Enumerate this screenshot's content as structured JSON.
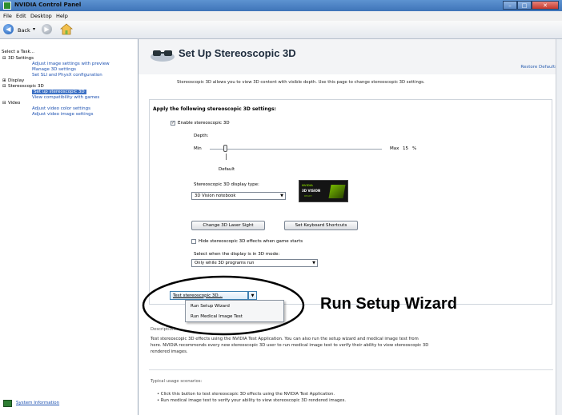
{
  "window": {
    "title": "NVIDIA Control Panel",
    "min": "–",
    "max": "□",
    "close": "✕"
  },
  "menu": {
    "file": "File",
    "edit": "Edit",
    "desktop": "Desktop",
    "help": "Help"
  },
  "toolbar": {
    "back": "Back",
    "back_arrow": "◀",
    "forward_arrow": "▶",
    "dropdown_arrow": "▾"
  },
  "sidebar": {
    "header": "Select a Task...",
    "items": [
      {
        "label": "3D Settings",
        "prefix": "⊟"
      },
      {
        "label": "Adjust image settings with preview"
      },
      {
        "label": "Manage 3D settings"
      },
      {
        "label": "Set SLI and PhysX configuration"
      },
      {
        "label": "Display",
        "prefix": "⊞"
      },
      {
        "label": "Stereoscopic 3D",
        "prefix": "⊟"
      },
      {
        "label": "Set up stereoscopic 3D"
      },
      {
        "label": "View compatibility with games"
      },
      {
        "label": "Video",
        "prefix": "⊟"
      },
      {
        "label": "Adjust video color settings"
      },
      {
        "label": "Adjust video image settings"
      }
    ],
    "system_info": "System Information"
  },
  "page": {
    "title": "Set Up Stereoscopic 3D",
    "restore": "Restore Defaults",
    "description": "Stereoscopic 3D allows you to view 3D content with visible depth. Use this page to change stereoscopic 3D settings.",
    "apply_heading": "Apply the following stereoscopic 3D settings:",
    "enable_label": "Enable stereoscopic 3D",
    "enable_checked": "✓",
    "depth_label": "Depth:",
    "depth_min": "Min",
    "depth_max": "Max",
    "depth_value": "15",
    "depth_unit": "%",
    "depth_default": "Default",
    "display_type_label": "Stereoscopic 3D display type:",
    "display_type_value": "3D Vision notebook",
    "badge": {
      "line1": "NVIDIA",
      "line2": "3D VISION",
      "line3": "READY"
    },
    "laser_button": "Change 3D Laser Sight",
    "shortcuts_button": "Set Keyboard Shortcuts",
    "hide_effects_label": "Hide stereoscopic 3D effects when game starts",
    "mode_label": "Select when the display is in 3D mode:",
    "mode_value": "Only while 3D programs run",
    "test_button": "Test stereoscopic 3D...",
    "menu_items": [
      "Run Setup Wizard",
      "Run Medical Image Test"
    ],
    "callout": "Run Setup Wizard",
    "desc_label": "Description:",
    "desc_lines": [
      "Test stereoscopic 3D effects using the NVIDIA Test Application. You can also run the setup wizard and medical image test from",
      "here. NVIDIA recommends every new stereoscopic 3D user to run medical image test to verify their ability to view stereoscopic 3D",
      "rendered images."
    ],
    "usage_label": "Typical usage scenarios:",
    "usage_lines": [
      "• Click this button to test stereoscopic 3D effects using the NVIDIA Test Application.",
      "• Run medical image test to verify your ability to view stereoscopic 3D rendered images."
    ]
  }
}
